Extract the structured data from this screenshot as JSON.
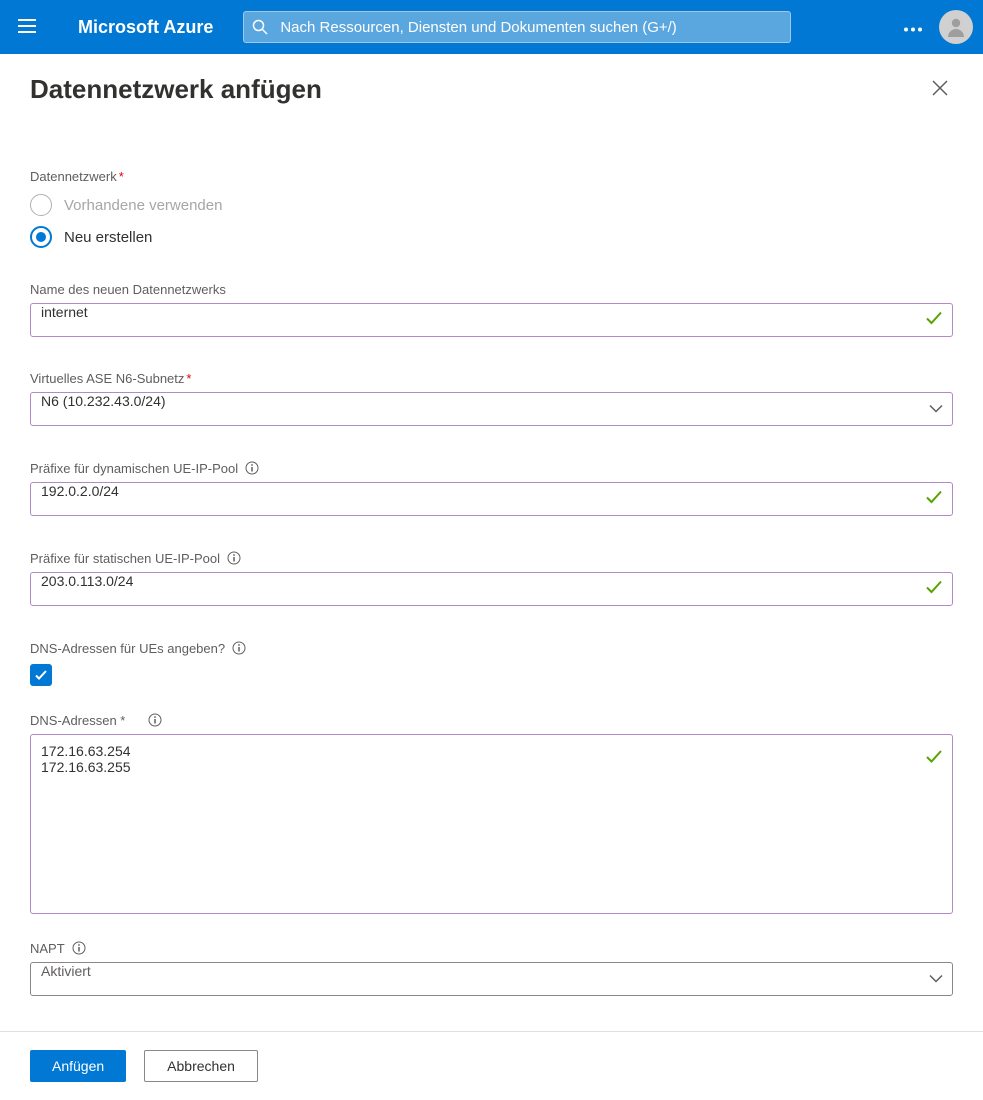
{
  "header": {
    "brand": "Microsoft Azure",
    "search_placeholder": "Nach Ressourcen, Diensten und Dokumenten suchen (G+/)"
  },
  "page": {
    "title": "Datennetzwerk anfügen"
  },
  "form": {
    "datennetzwerk": {
      "label": "Datennetzwerk",
      "option_existing": "Vorhandene verwenden",
      "option_new": "Neu erstellen",
      "selected": "new"
    },
    "name": {
      "label": "Name des neuen Datennetzwerks",
      "value": "internet"
    },
    "subnet": {
      "label": "Virtuelles ASE N6-Subnetz",
      "value": "N6 (10.232.43.0/24)"
    },
    "dyn_prefix": {
      "label": "Präfixe für dynamischen UE-IP-Pool",
      "value": "192.0.2.0/24"
    },
    "stat_prefix": {
      "label": "Präfixe für statischen UE-IP-Pool",
      "value": "203.0.113.0/24"
    },
    "dns_toggle": {
      "label": "DNS-Adressen für UEs angeben?",
      "checked": true
    },
    "dns_addresses": {
      "label": "DNS-Adressen *",
      "value": "172.16.63.254\n172.16.63.255"
    },
    "napt": {
      "label": "NAPT",
      "value": "Aktiviert"
    }
  },
  "footer": {
    "attach": "Anfügen",
    "cancel": "Abbrechen"
  }
}
